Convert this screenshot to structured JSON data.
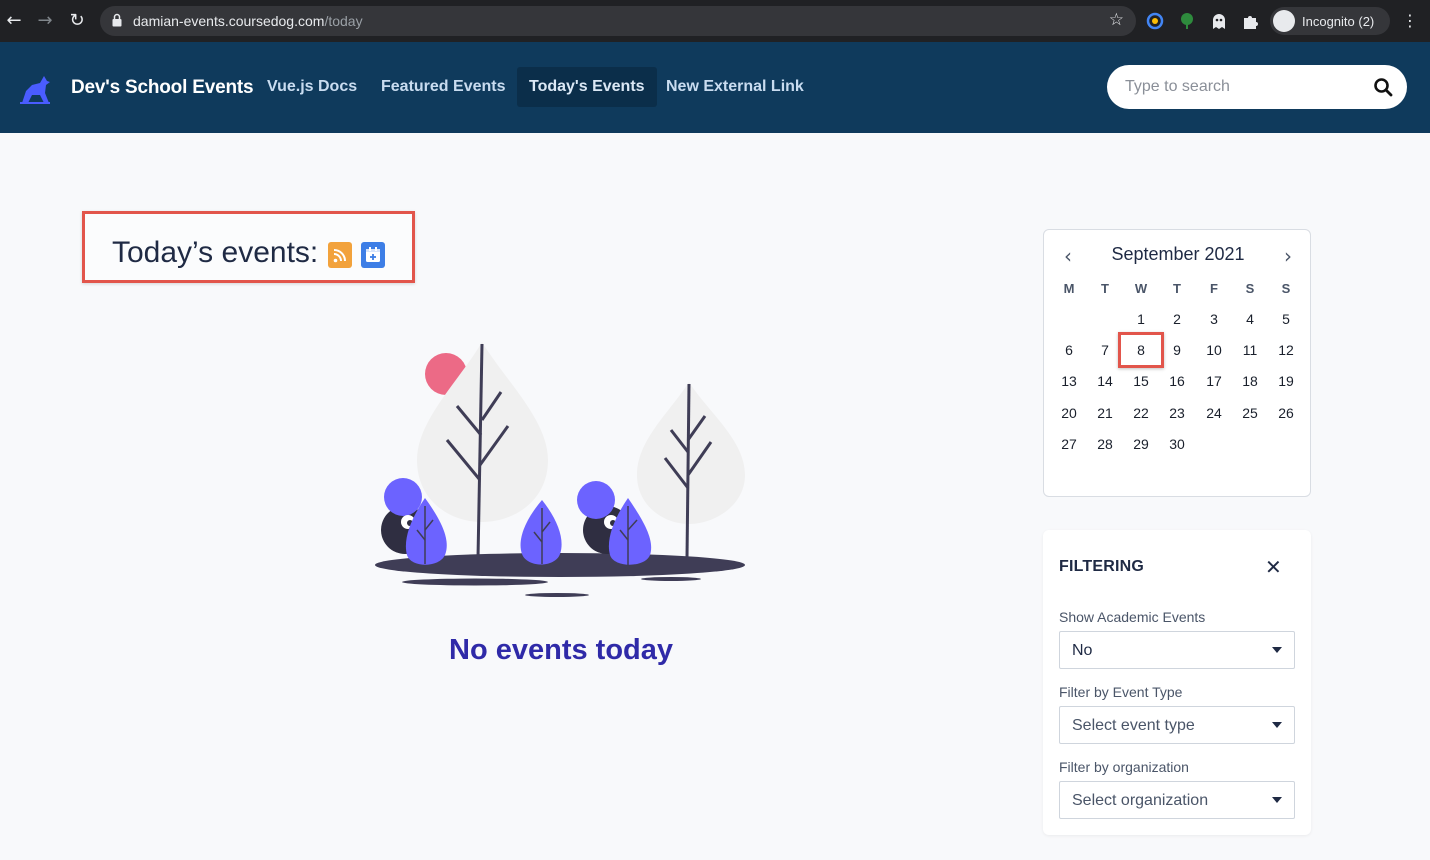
{
  "browser": {
    "url_host": "damian-events.coursedog.com",
    "url_path": "/today",
    "profile_label": "Incognito (2)"
  },
  "header": {
    "brand": "Dev's School Events",
    "nav": [
      {
        "label": "Vue.js Docs"
      },
      {
        "label": "Featured Events"
      },
      {
        "label": "Today's Events",
        "active": true
      },
      {
        "label": "New External Link"
      }
    ],
    "search_placeholder": "Type to search",
    "bg_color": "#0f3a5c"
  },
  "main": {
    "heading": "Today’s events:",
    "empty_message": "No events today"
  },
  "calendar": {
    "title": "September 2021",
    "weekdays": [
      "M",
      "T",
      "W",
      "T",
      "F",
      "S",
      "S"
    ],
    "weeks": [
      [
        "",
        "",
        "1",
        "2",
        "3",
        "4",
        "5"
      ],
      [
        "6",
        "7",
        "8",
        "9",
        "10",
        "11",
        "12"
      ],
      [
        "13",
        "14",
        "15",
        "16",
        "17",
        "18",
        "19"
      ],
      [
        "20",
        "21",
        "22",
        "23",
        "24",
        "25",
        "26"
      ],
      [
        "27",
        "28",
        "29",
        "30",
        "",
        "",
        ""
      ]
    ],
    "today": "8"
  },
  "filtering": {
    "title": "FILTERING",
    "close_icon": "close-icon",
    "academic_label": "Show Academic Events",
    "academic_value": "No",
    "event_type_label": "Filter by Event Type",
    "event_type_placeholder": "Select event type",
    "org_label": "Filter by organization",
    "org_placeholder": "Select organization"
  },
  "colors": {
    "highlight": "#e2554b",
    "accent_text": "#2f2aa8",
    "rss": "#f2a23c",
    "calendar_button": "#3d7ee6"
  }
}
